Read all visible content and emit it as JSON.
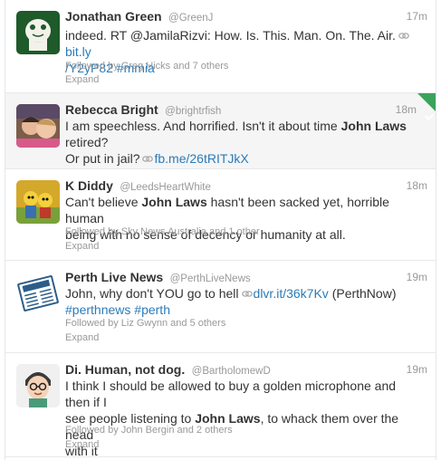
{
  "tweets": [
    {
      "name": "Jonathan Green",
      "handle": "@GreenJ",
      "time": "17m",
      "line1_a": "indeed. RT @JamilaRizvi: How. Is. This. Man. On. The. Air.",
      "line1_link": "bit.ly",
      "line2_link": "/Y2yP82",
      "line2_hash": "#mmia",
      "followed": "Followed by Greg Hicks and 7 others",
      "expand": "Expand"
    },
    {
      "name": "Rebecca Bright",
      "handle": "@brightrfish",
      "time": "18m",
      "line1_a": "I am speechless. And horrified. Isn't it about time",
      "line1_bold": "John Laws",
      "line1_b": "retired?",
      "line2_a": "Or put in jail?",
      "line2_link": "fb.me/26tRITJkX"
    },
    {
      "name": "K Diddy",
      "handle": "@LeedsHeartWhite",
      "time": "18m",
      "line1_a": "Can't believe",
      "line1_bold": "John Laws",
      "line1_b": "hasn't been sacked yet, horrible human",
      "line2_a": "being with no sense of decency or humanity at all.",
      "followed": "Followed by Sky News Australia and 1 other",
      "expand": "Expand"
    },
    {
      "name": "Perth Live News",
      "handle": "@PerthLiveNews",
      "time": "19m",
      "line1_a": "John, why don't YOU go to hell",
      "line1_link": "dlvr.it/36k7Kv",
      "line1_b": "(PerthNow)",
      "line2_hash1": "#perthnews",
      "line2_hash2": "#perth",
      "followed": "Followed by Liz Gwynn and 5 others",
      "expand": "Expand"
    },
    {
      "name": "Di. Human, not dog.",
      "handle": "@BartholomewD",
      "time": "19m",
      "line1_a": "I think I should be allowed to buy a golden microphone and then if I",
      "line2_a": "see people listening to",
      "line2_bold": "John Laws",
      "line2_b": ", to whack them over the head",
      "line3_a": "with it",
      "followed": "Followed by John Bergin and 2 others",
      "expand": "Expand"
    }
  ],
  "colors": {
    "link": "#2b7bb9",
    "muted": "#999999",
    "text": "#333333",
    "corner": "#3aa35b"
  }
}
